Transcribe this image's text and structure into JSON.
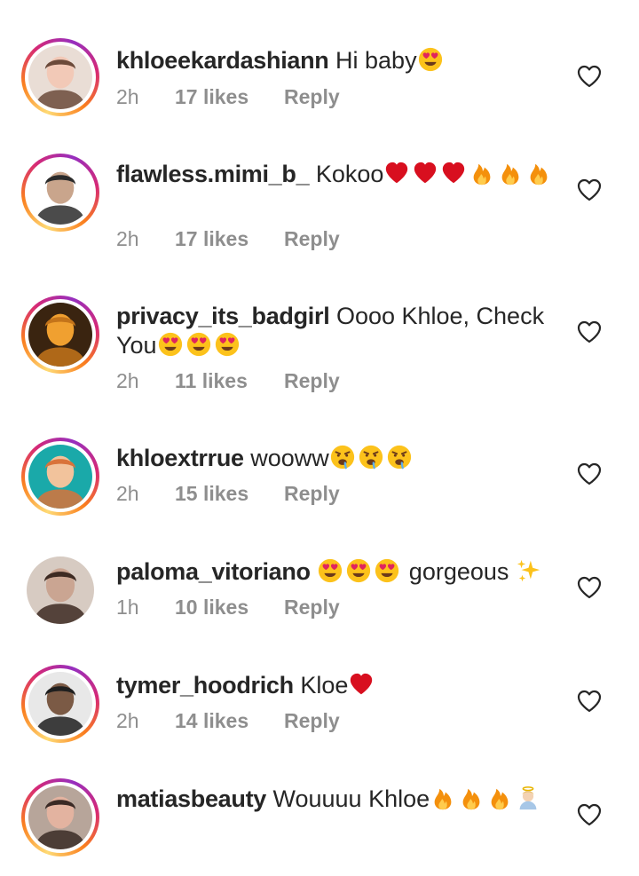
{
  "comments": [
    {
      "username": "khloeekardashiann",
      "text": "Hi baby",
      "emojis": [
        "heart-eyes"
      ],
      "time": "2h",
      "likes": "17 likes",
      "reply": "Reply",
      "story_ring": true,
      "avatar_colors": [
        "#e9ddd5",
        "#6b4a3a",
        "#f2c9b7"
      ]
    },
    {
      "username": "flawless.mimi_b_",
      "text": "Kokoo",
      "emojis": [
        "red-heart",
        "red-heart",
        "red-heart",
        "fire",
        "fire",
        "fire"
      ],
      "time": "2h",
      "likes": "17 likes",
      "reply": "Reply",
      "story_ring": true,
      "avatar_colors": [
        "#ffffff",
        "#2b2b2b",
        "#c9a58c"
      ]
    },
    {
      "username": "privacy_its_badgirl",
      "text": "Oooo Khloe, Check You",
      "emojis": [
        "heart-eyes",
        "heart-eyes",
        "heart-eyes"
      ],
      "time": "2h",
      "likes": "11 likes",
      "reply": "Reply",
      "story_ring": true,
      "avatar_colors": [
        "#3a2410",
        "#c4741a",
        "#f0a030"
      ]
    },
    {
      "username": "khloextrrue",
      "text": "wooww",
      "emojis": [
        "drooling",
        "drooling",
        "drooling"
      ],
      "time": "2h",
      "likes": "15 likes",
      "reply": "Reply",
      "story_ring": true,
      "avatar_colors": [
        "#1aa9a9",
        "#d9733a",
        "#f2c39c"
      ]
    },
    {
      "username": "paloma_vitoriano",
      "text": "gorgeous",
      "emojis_before": [
        "heart-eyes",
        "heart-eyes",
        "heart-eyes"
      ],
      "emojis_after": [
        "sparkles"
      ],
      "time": "1h",
      "likes": "10 likes",
      "reply": "Reply",
      "story_ring": false,
      "avatar_colors": [
        "#d7cbc2",
        "#3d2a22",
        "#caa592"
      ]
    },
    {
      "username": "tymer_hoodrich",
      "text": "Kloe",
      "emojis": [
        "red-heart"
      ],
      "time": "2h",
      "likes": "14 likes",
      "reply": "Reply",
      "story_ring": true,
      "avatar_colors": [
        "#e8e8e8",
        "#1f1f1f",
        "#7b5a45"
      ]
    },
    {
      "username": "matiasbeauty",
      "text": "Wouuuu Khloe",
      "emojis": [
        "fire",
        "fire",
        "fire",
        "angel-person"
      ],
      "time": "",
      "likes": "",
      "reply": "",
      "story_ring": true,
      "avatar_colors": [
        "#b7a59a",
        "#3a2a25",
        "#e3b3a0"
      ]
    }
  ],
  "icons": {
    "like": "heart-outline-icon"
  },
  "colors": {
    "text": "#262626",
    "meta": "#8e8e8e",
    "ring_start": "#feda75",
    "ring_end": "#d62976"
  }
}
